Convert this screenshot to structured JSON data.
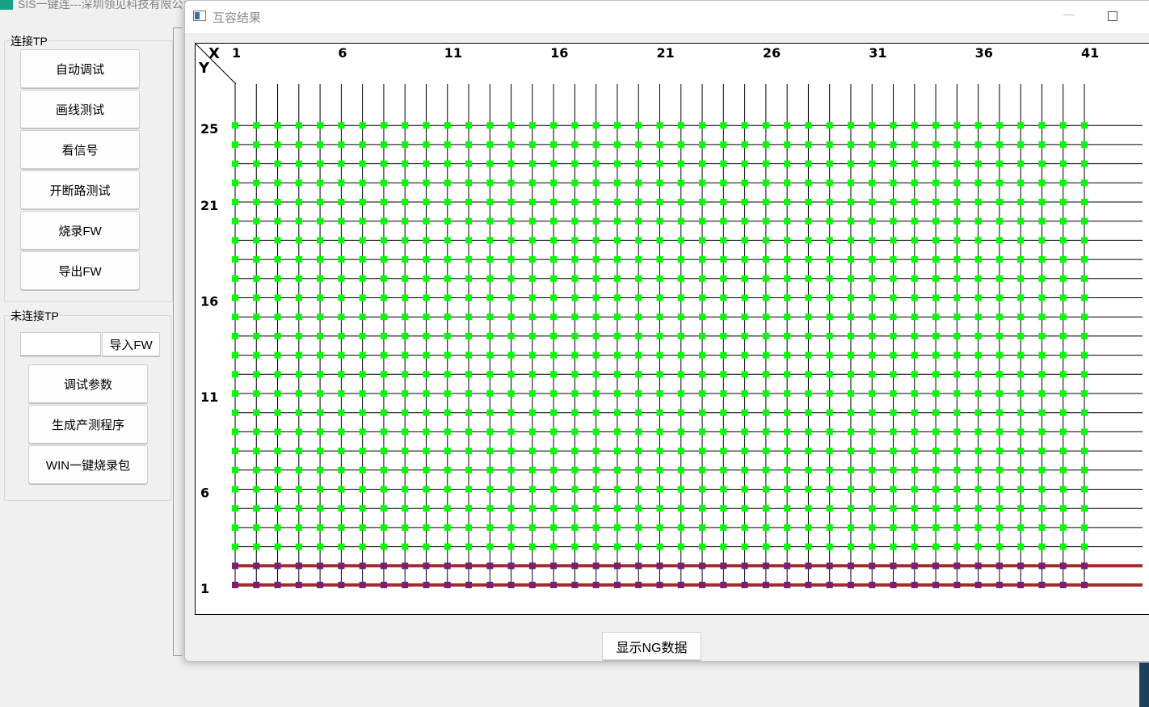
{
  "main_window": {
    "title": "SIS一键连---深圳领见科技有限公司"
  },
  "connected_group": {
    "label": "连接TP",
    "buttons": [
      "自动调试",
      "画线测试",
      "看信号",
      "开断路测试",
      "烧录FW",
      "导出FW"
    ]
  },
  "disconnected_group": {
    "label": "未连接TP",
    "fw_input_value": "",
    "import_fw_label": "导入FW",
    "buttons": [
      "调试参数",
      "生成产测程序",
      "WIN一键烧录包"
    ]
  },
  "dialog": {
    "title": "互容结果",
    "minimize_glyph": "—",
    "show_ng_label": "显示NG数据"
  },
  "chart_data": {
    "type": "heatmap",
    "x_axis_name": "X",
    "y_axis_name": "Y",
    "x_count": 41,
    "y_count": 25,
    "x_tick_labels": [
      "1",
      "6",
      "11",
      "16",
      "21",
      "26",
      "31",
      "36",
      "41"
    ],
    "y_tick_labels": [
      "25",
      "21",
      "16",
      "11",
      "6",
      "1"
    ],
    "colors": {
      "pass": "#00ff00",
      "fail": "#7b1f73",
      "fail_line": "#a52a2a",
      "grid_line": "#000000"
    },
    "failed_rows": [
      1,
      2
    ]
  }
}
